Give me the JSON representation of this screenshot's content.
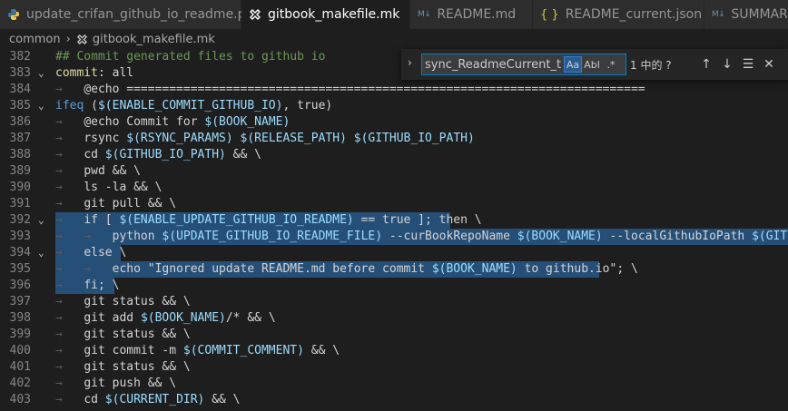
{
  "tabs": [
    {
      "label": "update_crifan_github_io_readme.py",
      "icon": "python-icon",
      "active": false
    },
    {
      "label": "gitbook_makefile.mk",
      "icon": "makefile-icon",
      "active": true
    },
    {
      "label": "README.md",
      "icon": "markdown-icon",
      "active": false
    },
    {
      "label": "README_current.json",
      "icon": "json-icon",
      "active": false
    },
    {
      "label": "SUMMAR",
      "icon": "markdown-icon",
      "active": false
    }
  ],
  "icon_text": {
    "markdown": "M↓",
    "json": "{ }"
  },
  "breadcrumb": {
    "folder": "common",
    "file": "gitbook_makefile.mk"
  },
  "find": {
    "query": "sync_ReadmeCurrent_to_I",
    "match_case": "Aa",
    "whole_word": "Abl",
    "regex": ".*",
    "result": "1 中的 ?"
  },
  "colors": {
    "selection": "#264f78",
    "comment": "#6a9955",
    "keyword": "#569cd6",
    "variable": "#9cdcfe",
    "function": "#dcdcaa",
    "string": "#ce9178"
  },
  "code_lines": [
    {
      "num": "382",
      "fold": "",
      "sel": [
        0,
        0
      ],
      "parts": [
        [
          "cmt",
          "## Commit generated files to github io"
        ]
      ]
    },
    {
      "num": "383",
      "fold": "open",
      "sel": [
        0,
        0
      ],
      "parts": [
        [
          "fn",
          "commit"
        ],
        [
          "",
          "​: all"
        ]
      ]
    },
    {
      "num": "384",
      "fold": "",
      "sel": [
        0,
        0
      ],
      "parts": [
        [
          "arrow",
          "→   "
        ],
        [
          "",
          "@echo ========================================================================="
        ]
      ]
    },
    {
      "num": "385",
      "fold": "open",
      "sel": [
        0,
        0
      ],
      "parts": [
        [
          "kw",
          "ifeq"
        ],
        [
          "",
          " ("
        ],
        [
          "var",
          "$(ENABLE_COMMIT_GITHUB_IO)"
        ],
        [
          "",
          ", true)"
        ]
      ]
    },
    {
      "num": "386",
      "fold": "",
      "sel": [
        0,
        0
      ],
      "parts": [
        [
          "arrow",
          "→   "
        ],
        [
          "",
          "@echo Commit for "
        ],
        [
          "var",
          "$(BOOK_NAME)"
        ]
      ]
    },
    {
      "num": "387",
      "fold": "",
      "sel": [
        0,
        0
      ],
      "parts": [
        [
          "arrow",
          "→   "
        ],
        [
          "",
          "rsync "
        ],
        [
          "var",
          "$(RSYNC_PARAMS)"
        ],
        [
          "",
          " "
        ],
        [
          "var",
          "$(RELEASE_PATH)"
        ],
        [
          "",
          " "
        ],
        [
          "var",
          "$(GITHUB_IO_PATH)"
        ]
      ]
    },
    {
      "num": "388",
      "fold": "",
      "sel": [
        0,
        0
      ],
      "parts": [
        [
          "arrow",
          "→   "
        ],
        [
          "",
          "cd "
        ],
        [
          "var",
          "$(GITHUB_IO_PATH)"
        ],
        [
          "",
          " && \\"
        ]
      ]
    },
    {
      "num": "389",
      "fold": "",
      "sel": [
        0,
        0
      ],
      "parts": [
        [
          "arrow",
          "→   "
        ],
        [
          "",
          "pwd && \\"
        ]
      ]
    },
    {
      "num": "390",
      "fold": "",
      "sel": [
        0,
        0
      ],
      "parts": [
        [
          "arrow",
          "→   "
        ],
        [
          "",
          "ls -la && \\"
        ]
      ]
    },
    {
      "num": "391",
      "fold": "",
      "sel": [
        0,
        0
      ],
      "parts": [
        [
          "arrow",
          "→   "
        ],
        [
          "",
          "git pull && \\"
        ]
      ]
    },
    {
      "num": "392",
      "fold": "open",
      "sel": [
        61,
        496
      ],
      "parts": [
        [
          "arrow",
          "→   "
        ],
        [
          "",
          "if [ "
        ],
        [
          "var",
          "$(ENABLE_UPDATE_GITHUB_IO_README)"
        ],
        [
          "",
          " == true ]; then \\"
        ]
      ]
    },
    {
      "num": "393",
      "fold": "",
      "sel": [
        61,
        868
      ],
      "parts": [
        [
          "arrow",
          "→   →   "
        ],
        [
          "",
          "python "
        ],
        [
          "var",
          "$(UPDATE_GITHUB_IO_README_FILE)"
        ],
        [
          "",
          " --curBookRepoName "
        ],
        [
          "var",
          "$(BOOK_NAME)"
        ],
        [
          "",
          " --localGithubIoPath "
        ],
        [
          "var",
          "$(GITHUB_IO_PATH)"
        ]
      ]
    },
    {
      "num": "394",
      "fold": "open",
      "sel": [
        61,
        133
      ],
      "parts": [
        [
          "arrow",
          "→   "
        ],
        [
          "",
          "else \\"
        ]
      ]
    },
    {
      "num": "395",
      "fold": "",
      "sel": [
        61,
        660
      ],
      "parts": [
        [
          "arrow",
          "→   →   "
        ],
        [
          "",
          "echo \"Ignored update README.md before commit "
        ],
        [
          "var",
          "$(BOOK_NAME)"
        ],
        [
          "",
          " to github.io\"; \\"
        ]
      ]
    },
    {
      "num": "396",
      "fold": "",
      "sel": [
        61,
        126
      ],
      "parts": [
        [
          "arrow",
          "→   "
        ],
        [
          "",
          "fi; \\"
        ]
      ]
    },
    {
      "num": "397",
      "fold": "",
      "sel": [
        0,
        0
      ],
      "parts": [
        [
          "arrow",
          "→   "
        ],
        [
          "",
          "git status && \\"
        ]
      ]
    },
    {
      "num": "398",
      "fold": "",
      "sel": [
        0,
        0
      ],
      "parts": [
        [
          "arrow",
          "→   "
        ],
        [
          "",
          "git add "
        ],
        [
          "var",
          "$(BOOK_NAME)"
        ],
        [
          "",
          "/* && \\"
        ]
      ]
    },
    {
      "num": "399",
      "fold": "",
      "sel": [
        0,
        0
      ],
      "parts": [
        [
          "arrow",
          "→   "
        ],
        [
          "",
          "git status && \\"
        ]
      ]
    },
    {
      "num": "400",
      "fold": "",
      "sel": [
        0,
        0
      ],
      "parts": [
        [
          "arrow",
          "→   "
        ],
        [
          "",
          "git commit -m "
        ],
        [
          "var",
          "$(COMMIT_COMMENT)"
        ],
        [
          "",
          " && \\"
        ]
      ]
    },
    {
      "num": "401",
      "fold": "",
      "sel": [
        0,
        0
      ],
      "parts": [
        [
          "arrow",
          "→   "
        ],
        [
          "",
          "git status && \\"
        ]
      ]
    },
    {
      "num": "402",
      "fold": "",
      "sel": [
        0,
        0
      ],
      "parts": [
        [
          "arrow",
          "→   "
        ],
        [
          "",
          "git push && \\"
        ]
      ]
    },
    {
      "num": "403",
      "fold": "",
      "sel": [
        0,
        0
      ],
      "parts": [
        [
          "arrow",
          "→   "
        ],
        [
          "",
          "cd "
        ],
        [
          "var",
          "$(CURRENT_DIR)"
        ],
        [
          "",
          " && \\"
        ]
      ]
    }
  ]
}
